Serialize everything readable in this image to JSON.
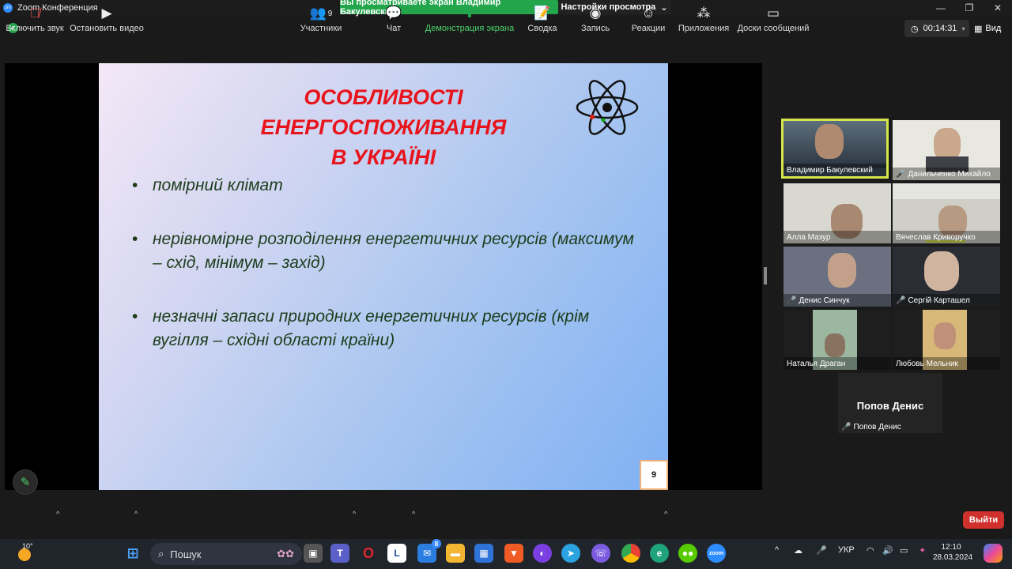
{
  "titlebar": {
    "app_title": "Zoom Конференция",
    "app_logo": "zm"
  },
  "share_banner": {
    "text": "Вы просматриваете экран Владимир Бакулевский"
  },
  "view_settings": {
    "label": "Настройки просмотра",
    "caret": "⌄"
  },
  "timer": {
    "value": "00:14:31"
  },
  "view_button": {
    "label": "Вид"
  },
  "slide": {
    "title_lines": [
      "ОСОБЛИВОСТІ",
      "ЕНЕРГОСПОЖИВАННЯ",
      "В УКРАЇНІ"
    ],
    "bullets": [
      "помірний клімат",
      "нерівномірне розподілення енергетичних ресурсів (максимум – схід, мінімум – захід)",
      "незначні запаси природних енергетичних ресурсів (крім вугілля – східні області країни)"
    ],
    "bullet_marker": "•",
    "page_number": "9"
  },
  "participants": [
    {
      "name": "Владимир Бакулевский",
      "muted": false,
      "active": true
    },
    {
      "name": "Данильченко Михайло",
      "muted": true,
      "active": false
    },
    {
      "name": "Алла Мазур",
      "muted": false,
      "active": false
    },
    {
      "name": "Вячеслав Криворучко",
      "muted": false,
      "active": false
    },
    {
      "name": "Денис Синчук",
      "muted": true,
      "active": false
    },
    {
      "name": "Сергій Карташел",
      "muted": true,
      "active": false
    },
    {
      "name": "Наталья Драган",
      "muted": false,
      "active": false
    },
    {
      "name": "Любовь Мельник",
      "muted": false,
      "active": false
    },
    {
      "name": "Попов Денис",
      "muted": true,
      "active": false,
      "no_video_label": "Попов Денис"
    }
  ],
  "toolbar": {
    "unmute": "Включить звук",
    "stop_video": "Остановить видео",
    "participants": "Участники",
    "participants_count": "9",
    "chat": "Чат",
    "share_screen": "Демонстрация экрана",
    "summary": "Сводка",
    "record": "Запись",
    "reactions": "Реакции",
    "apps": "Приложения",
    "whiteboards": "Доски сообщений",
    "end": "Выйти"
  },
  "taskbar": {
    "temperature": "10°",
    "search_placeholder": "Пошук",
    "mail_badge": "8",
    "language": "УКР",
    "time": "12:10",
    "date": "28.03.2024"
  },
  "colors": {
    "banner": "#23a54b",
    "end": "#d0312d",
    "slide_title": "#e8141b",
    "active_speaker": "#d6e64a"
  }
}
